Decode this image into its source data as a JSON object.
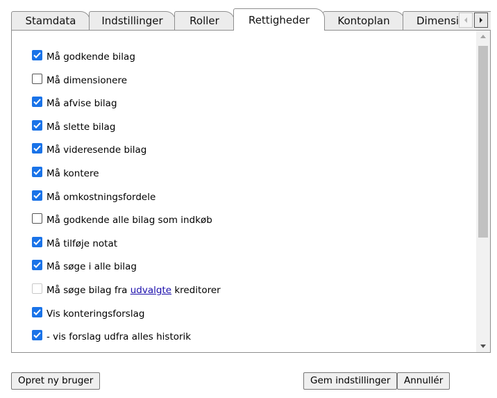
{
  "tabs": [
    {
      "label": "Stamdata",
      "active": false
    },
    {
      "label": "Indstillinger",
      "active": false
    },
    {
      "label": "Roller",
      "active": false
    },
    {
      "label": "Rettigheder",
      "active": true
    },
    {
      "label": "Kontoplan",
      "active": false
    },
    {
      "label": "Dimensic",
      "active": false
    }
  ],
  "permissions": [
    {
      "label": "Må godkende bilag",
      "state": "checked"
    },
    {
      "label": "Må dimensionere",
      "state": "unchecked"
    },
    {
      "label": "Må afvise bilag",
      "state": "checked"
    },
    {
      "label": "Må slette bilag",
      "state": "checked"
    },
    {
      "label": "Må videresende bilag",
      "state": "checked"
    },
    {
      "label": "Må kontere",
      "state": "checked"
    },
    {
      "label": "Må omkostningsfordele",
      "state": "checked"
    },
    {
      "label": "Må godkende alle bilag som indkøb",
      "state": "unchecked"
    },
    {
      "label": "Må tilføje notat",
      "state": "checked"
    },
    {
      "label": "Må søge i alle bilag",
      "state": "checked"
    },
    {
      "label": "Må søge bilag fra",
      "link": "udvalgte",
      "suffix": "kreditorer",
      "state": "disabled"
    },
    {
      "label": "Vis konteringsforslag",
      "state": "checked"
    },
    {
      "label": "- vis forslag udfra alles historik",
      "state": "checked"
    }
  ],
  "buttons": {
    "new_user": "Opret ny bruger",
    "save": "Gem indstillinger",
    "cancel": "Annullér"
  },
  "colors": {
    "checkbox_accent": "#1a73e8",
    "link": "#1a0dab"
  },
  "icons": {
    "tab_scroll_left": "chevron-left-icon",
    "tab_scroll_right": "chevron-right-icon",
    "scroll_up": "scroll-up-arrow-icon",
    "scroll_down": "scroll-down-arrow-icon",
    "checkmark": "checkmark-icon"
  }
}
